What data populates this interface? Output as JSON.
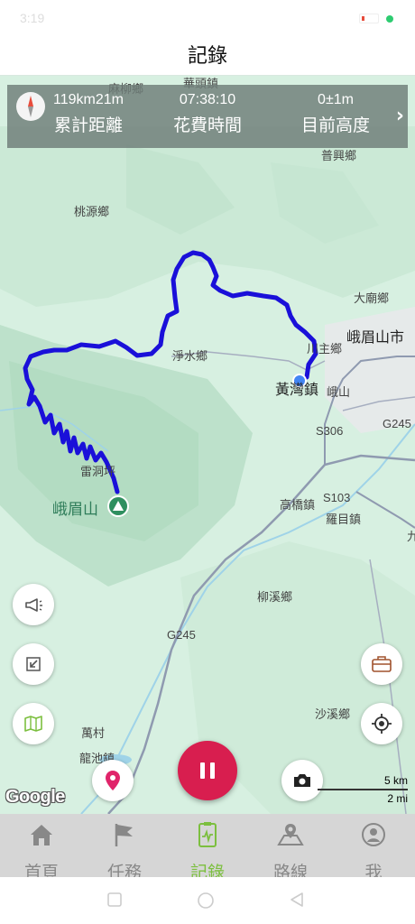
{
  "status_bar": {
    "time": "3:19"
  },
  "header": {
    "title": "記錄"
  },
  "stats": {
    "distance_value": "119km21m",
    "distance_label": "累計距離",
    "time_value": "07:38:10",
    "time_label": "花費時間",
    "altitude_value": "0±1m",
    "altitude_label": "目前高度"
  },
  "map": {
    "labels": {
      "mayiu": "麻柳鄉",
      "huatou": "華頭鎮",
      "puxing": "普興鄉",
      "taoyuan": "桃源鄉",
      "damiao": "大廟鄉",
      "emeishan_city": "峨眉山市",
      "chuanzhu": "川主鄉",
      "jingshui": "淨水鄉",
      "huangwan": "黃灣鎮",
      "emei": "峨山",
      "leidongping": "雷洞坪",
      "emeishan": "峨眉山",
      "gaoqiao": "高橋鎮",
      "luomu": "羅目鎮",
      "liuxi": "柳溪鄉",
      "shaxi": "沙溪鄉",
      "wancun": "萬村",
      "longchi": "龍池鎮",
      "road_s306": "S306",
      "road_g245_a": "G245",
      "road_s103": "S103",
      "road_g245_b": "G245",
      "edge_jiu": "九"
    },
    "scale_km": "5 km",
    "scale_mi": "2 mi",
    "attribution": "Google"
  },
  "tabs": [
    {
      "label": "首頁",
      "icon": "home-icon"
    },
    {
      "label": "任務",
      "icon": "flag-icon"
    },
    {
      "label": "記錄",
      "icon": "record-icon"
    },
    {
      "label": "路線",
      "icon": "route-icon"
    },
    {
      "label": "我",
      "icon": "profile-icon"
    }
  ],
  "colors": {
    "accent": "#7cbf3f",
    "track": "#1a10d9",
    "pause": "#d81e4f"
  }
}
